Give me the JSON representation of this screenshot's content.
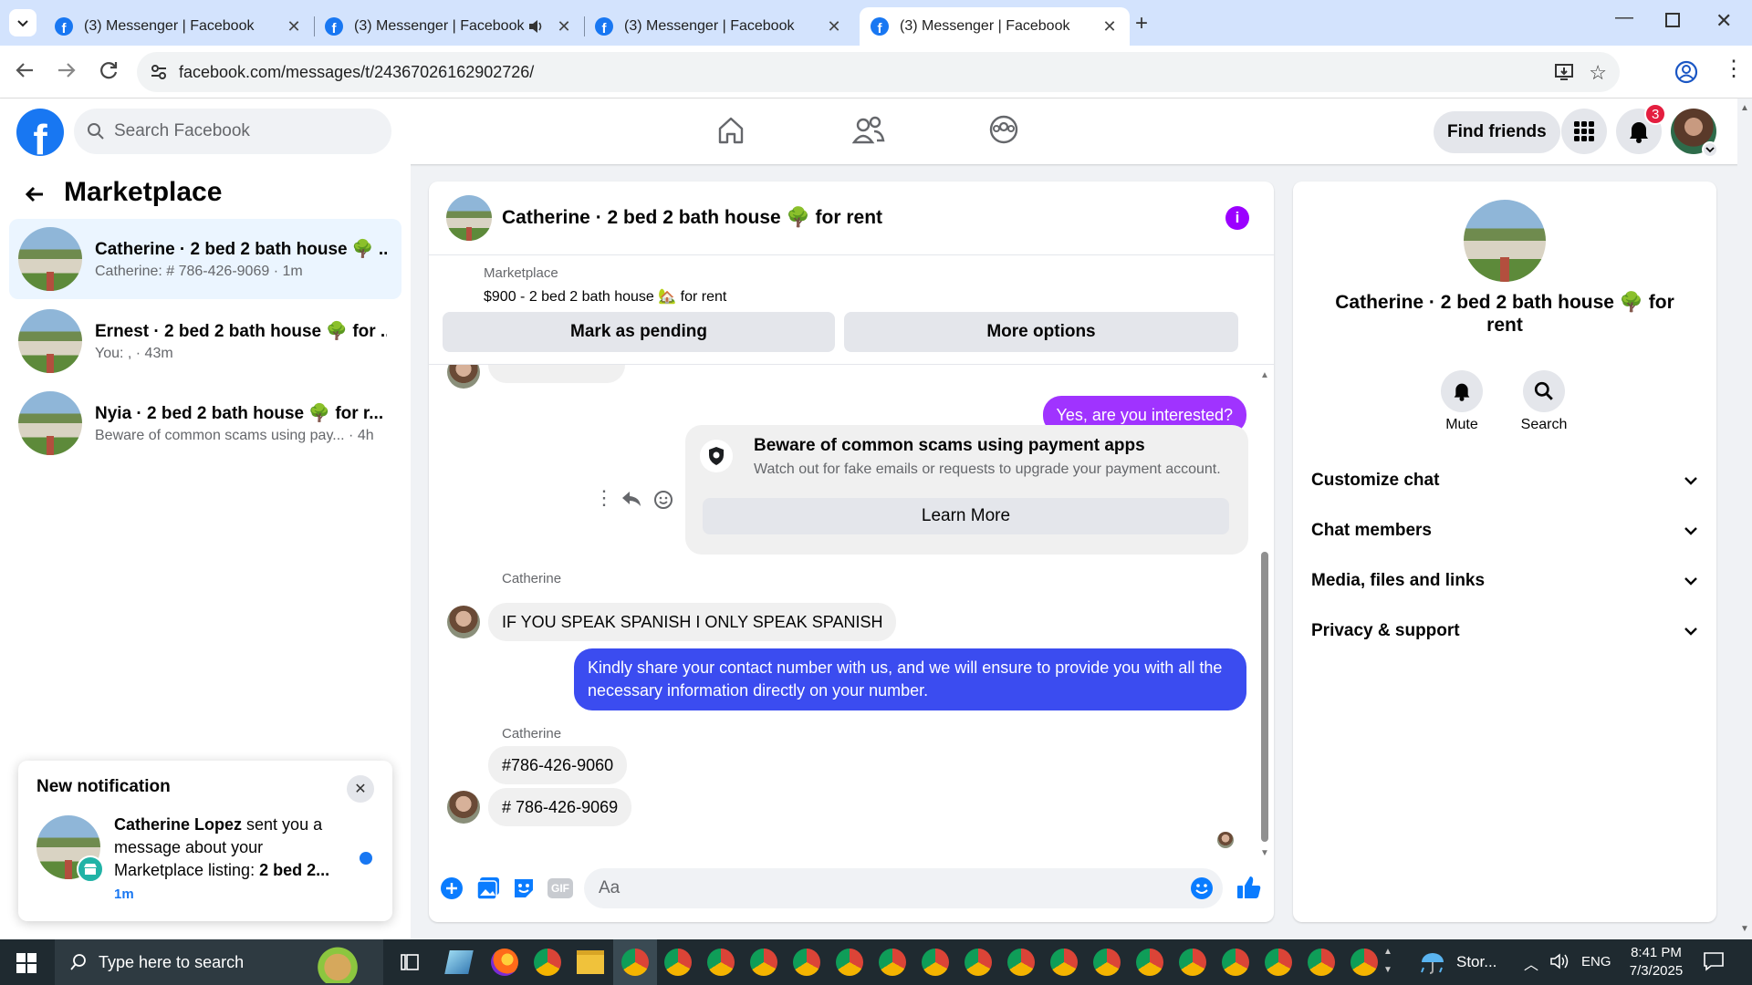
{
  "browser": {
    "tabs": [
      {
        "title": "(3) Messenger | Facebook",
        "active": false,
        "audio": false
      },
      {
        "title": "(3) Messenger | Facebook",
        "active": false,
        "audio": true
      },
      {
        "title": "(3) Messenger | Facebook",
        "active": false,
        "audio": false
      },
      {
        "title": "(3) Messenger | Facebook",
        "active": true,
        "audio": false
      }
    ],
    "url": "facebook.com/messages/t/24367026162902726/"
  },
  "header": {
    "search_placeholder": "Search Facebook",
    "find_friends": "Find friends",
    "notification_count": "3"
  },
  "sidebar": {
    "title": "Marketplace",
    "conversations": [
      {
        "name": "Catherine · 2 bed 2 bath house 🌳 ...",
        "preview": "Catherine: # 786-426-9069 · 1m",
        "active": true
      },
      {
        "name": "Ernest · 2 bed 2 bath house 🌳 for ...",
        "preview": "You: , · 43m",
        "active": false
      },
      {
        "name": "Nyia · 2 bed 2 bath house 🌳 for r...",
        "preview": "Beware of common scams using pay...  · 4h",
        "active": false
      }
    ]
  },
  "chat": {
    "title": "Catherine · 2 bed 2 bath house 🌳 for rent",
    "listing_label": "Marketplace",
    "listing_detail": "$900 - 2 bed 2 bath house 🏡 for rent",
    "mark_pending": "Mark as pending",
    "more_options": "More options",
    "messages": {
      "out1": "Yes, are you interested?",
      "scam_title": "Beware of common scams using payment apps",
      "scam_body": "Watch out for fake emails or requests to upgrade your payment account.",
      "learn_more": "Learn More",
      "sender1": "Catherine",
      "in1": "IF YOU SPEAK SPANISH I ONLY SPEAK SPANISH",
      "out2": "Kindly share your contact number with us, and we will ensure to provide you with all the necessary information directly on your number.",
      "sender2": "Catherine",
      "in2": "#786-426-9060",
      "in3": "# 786-426-9069"
    },
    "composer_placeholder": "Aa"
  },
  "details": {
    "title": "Catherine · 2 bed 2 bath house 🌳 for rent",
    "mute": "Mute",
    "search": "Search",
    "sections": [
      "Customize chat",
      "Chat members",
      "Media, files and links",
      "Privacy & support"
    ]
  },
  "notification": {
    "heading": "New notification",
    "name": "Catherine Lopez",
    "text": " sent you a message about your Marketplace listing: ",
    "listing": "2 bed 2...",
    "time": "1m"
  },
  "taskbar": {
    "search_placeholder": "Type here to search",
    "weather": "Stor...",
    "language": "ENG",
    "time": "8:41 PM",
    "date": "7/3/2025"
  },
  "colors": {
    "brand": "#1877f2",
    "bubble_gradient_top": "#a033ff",
    "bubble_gradient_bottom": "#3b4cf0",
    "notif_badge": "#e41e3f",
    "info_icon": "#9b00ff"
  }
}
